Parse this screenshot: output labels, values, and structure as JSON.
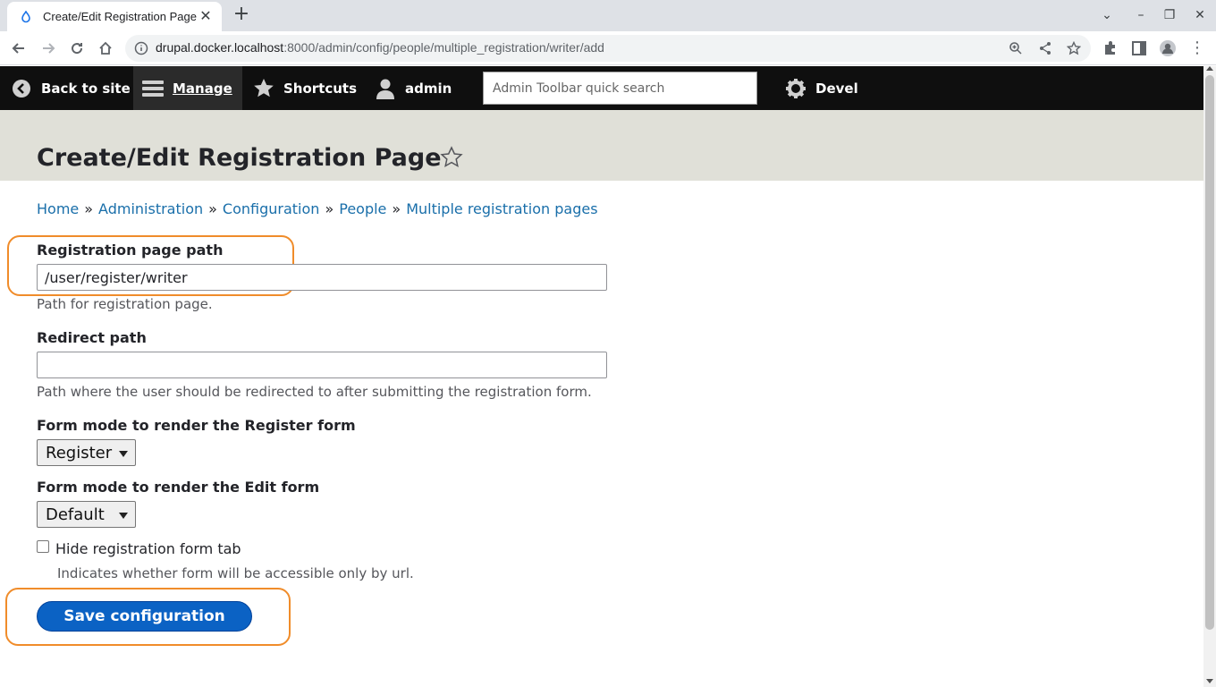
{
  "browser": {
    "tab_title": "Create/Edit Registration Page",
    "url_host": "drupal.docker.localhost",
    "url_rest": ":8000/admin/config/people/multiple_registration/writer/add"
  },
  "toolbar": {
    "back_to_site": "Back to site",
    "manage": "Manage",
    "shortcuts": "Shortcuts",
    "user": "admin",
    "search_placeholder": "Admin Toolbar quick search",
    "devel": "Devel"
  },
  "page": {
    "title": "Create/Edit Registration Page"
  },
  "breadcrumb": [
    "Home",
    "Administration",
    "Configuration",
    "People",
    "Multiple registration pages"
  ],
  "form": {
    "path_label": "Registration page path",
    "path_value": "/user/register/writer",
    "path_desc": "Path for registration page.",
    "redirect_label": "Redirect path",
    "redirect_value": "",
    "redirect_desc": "Path where the user should be redirected to after submitting the registration form.",
    "register_mode_label": "Form mode to render the Register form",
    "register_mode_value": "Register",
    "edit_mode_label": "Form mode to render the Edit form",
    "edit_mode_value": "Default",
    "hide_tab_label": "Hide registration form tab",
    "hide_tab_desc": "Indicates whether form will be accessible only by url.",
    "save_label": "Save configuration"
  },
  "colors": {
    "highlight": "#f08c2a",
    "primary_button": "#0b62c4",
    "link": "#1a6faa"
  }
}
